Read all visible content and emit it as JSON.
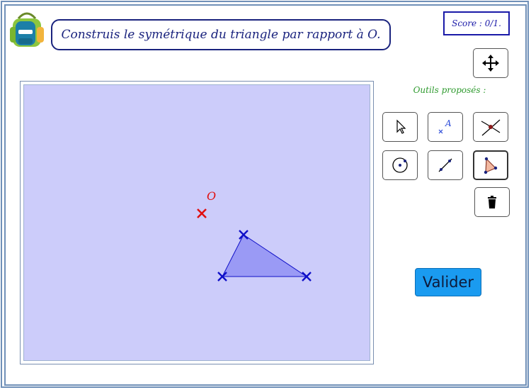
{
  "instruction": "Construis le symétrique du triangle par rapport à O.",
  "score": "Score : 0/1.",
  "tools_label": "Outils proposés :",
  "validate_label": "Valider",
  "center_point": {
    "label": "O",
    "color": "#e01010"
  },
  "triangle": {
    "fill": "#9a9af5",
    "stroke": "#1010c8"
  },
  "icons": {
    "logo": "backpack-icon",
    "move": "move-arrows-icon",
    "pointer": "pointer-icon",
    "point": "point-icon",
    "intersection": "intersection-icon",
    "circle": "circle-center-icon",
    "segment": "segment-icon",
    "polygon": "polygon-icon",
    "delete": "trash-icon"
  }
}
